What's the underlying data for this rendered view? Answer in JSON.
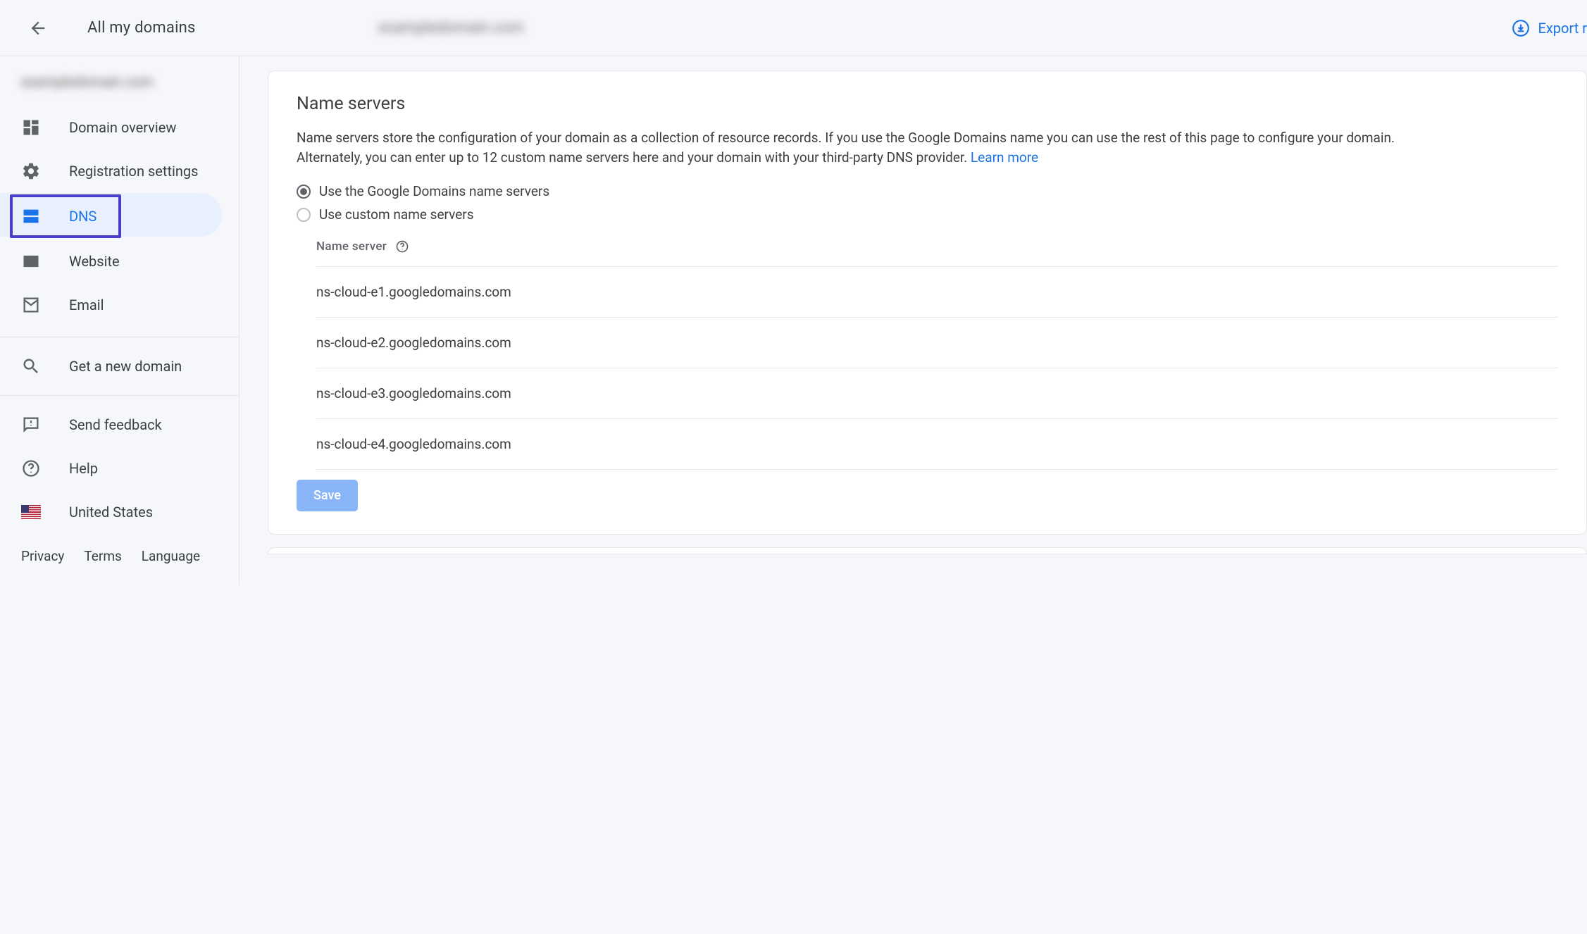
{
  "topbar": {
    "back_label": "All my domains",
    "domain_blurred": "exampledomain.com",
    "export_label": "Export r"
  },
  "sidebar": {
    "domain_blurred": "exampledomain.com",
    "items": {
      "overview": "Domain overview",
      "registration": "Registration settings",
      "dns": "DNS",
      "website": "Website",
      "email": "Email",
      "get_domain": "Get a new domain",
      "feedback": "Send feedback",
      "help": "Help",
      "locale": "United States"
    },
    "footer": {
      "privacy": "Privacy",
      "terms": "Terms",
      "language": "Language"
    }
  },
  "main": {
    "card_title": "Name servers",
    "description": "Name servers store the configuration of your domain as a collection of resource records. If you use the Google Domains name you can use the rest of this page to configure your domain. Alternately, you can enter up to 12 custom name servers here and your domain with your third-party DNS provider. ",
    "learn_more": "Learn more",
    "radio_google": "Use the Google Domains name servers",
    "radio_custom": "Use custom name servers",
    "ns_header": "Name server",
    "name_servers": [
      "ns-cloud-e1.googledomains.com",
      "ns-cloud-e2.googledomains.com",
      "ns-cloud-e3.googledomains.com",
      "ns-cloud-e4.googledomains.com"
    ],
    "save_label": "Save"
  }
}
